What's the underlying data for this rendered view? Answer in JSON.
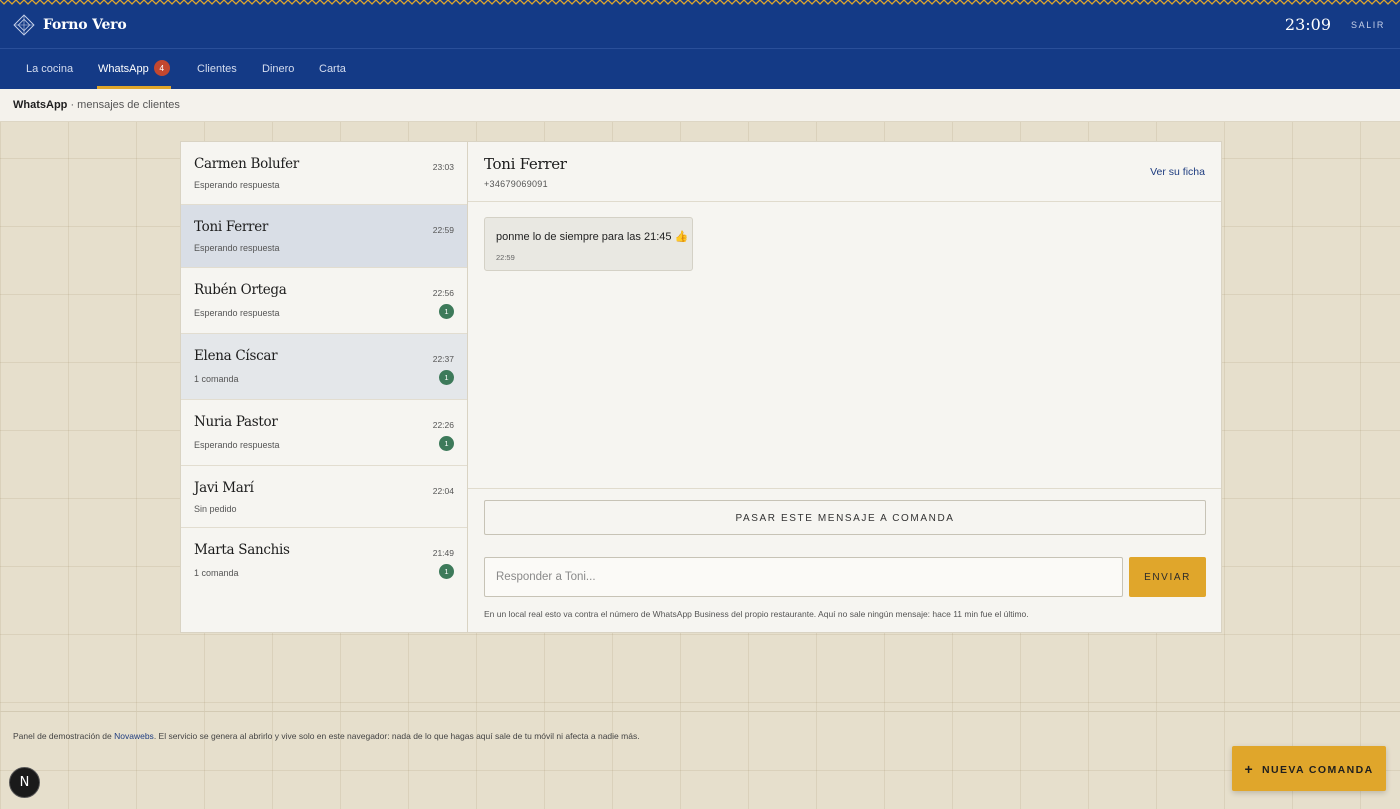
{
  "app": {
    "brand": "Forno Vero",
    "clock": "23:09",
    "logout_label": "SALIR"
  },
  "nav": {
    "items": [
      {
        "label": "La cocina",
        "active": false
      },
      {
        "label": "WhatsApp",
        "active": true,
        "badge": "4"
      },
      {
        "label": "Clientes",
        "active": false
      },
      {
        "label": "Dinero",
        "active": false
      },
      {
        "label": "Carta",
        "active": false
      }
    ]
  },
  "breadcrumb": {
    "section": "WhatsApp",
    "subtitle": "· mensajes de clientes"
  },
  "conversations": [
    {
      "name": "Carmen Bolufer",
      "status": "Esperando respuesta",
      "time": "23:03",
      "count": null
    },
    {
      "name": "Toni Ferrer",
      "status": "Esperando respuesta",
      "time": "22:59",
      "count": null,
      "selected": true
    },
    {
      "name": "Rubén Ortega",
      "status": "Esperando respuesta",
      "time": "22:56",
      "count": "1"
    },
    {
      "name": "Elena Císcar",
      "status": "1 comanda",
      "time": "22:37",
      "count": "1"
    },
    {
      "name": "Nuria Pastor",
      "status": "Esperando respuesta",
      "time": "22:26",
      "count": "1"
    },
    {
      "name": "Javi Marí",
      "status": "Sin pedido",
      "time": "22:04",
      "count": null
    },
    {
      "name": "Marta Sanchis",
      "status": "1 comanda",
      "time": "21:49",
      "count": "1"
    }
  ],
  "chat": {
    "name": "Toni Ferrer",
    "phone": "+34679069091",
    "profile_link": "Ver su ficha",
    "messages": [
      {
        "text": "ponme lo de siempre para las 21:45 👍",
        "time": "22:59"
      }
    ],
    "convert_button": "PASAR ESTE MENSAJE A COMANDA",
    "reply_placeholder": "Responder a Toni...",
    "send_button": "ENVIAR",
    "note": "En un local real esto va contra el número de WhatsApp Business del propio restaurante. Aquí no sale ningún mensaje: hace 11 min fue el último."
  },
  "footer": {
    "disclaimer_prefix": "Panel de demostración de ",
    "disclaimer_link": "Novawebs",
    "disclaimer_suffix": ". El servicio se genera al abrirlo y vive solo en este navegador: nada de lo que hagas aquí sale de tu móvil ni afecta a nadie más.",
    "n_button": "N",
    "new_order_label": "NUEVA COMANDA"
  },
  "colors": {
    "header_blue": "#143a86",
    "accent_gold": "#e0a62b",
    "badge_red": "#c2472f",
    "count_green": "#3d7a5a"
  }
}
